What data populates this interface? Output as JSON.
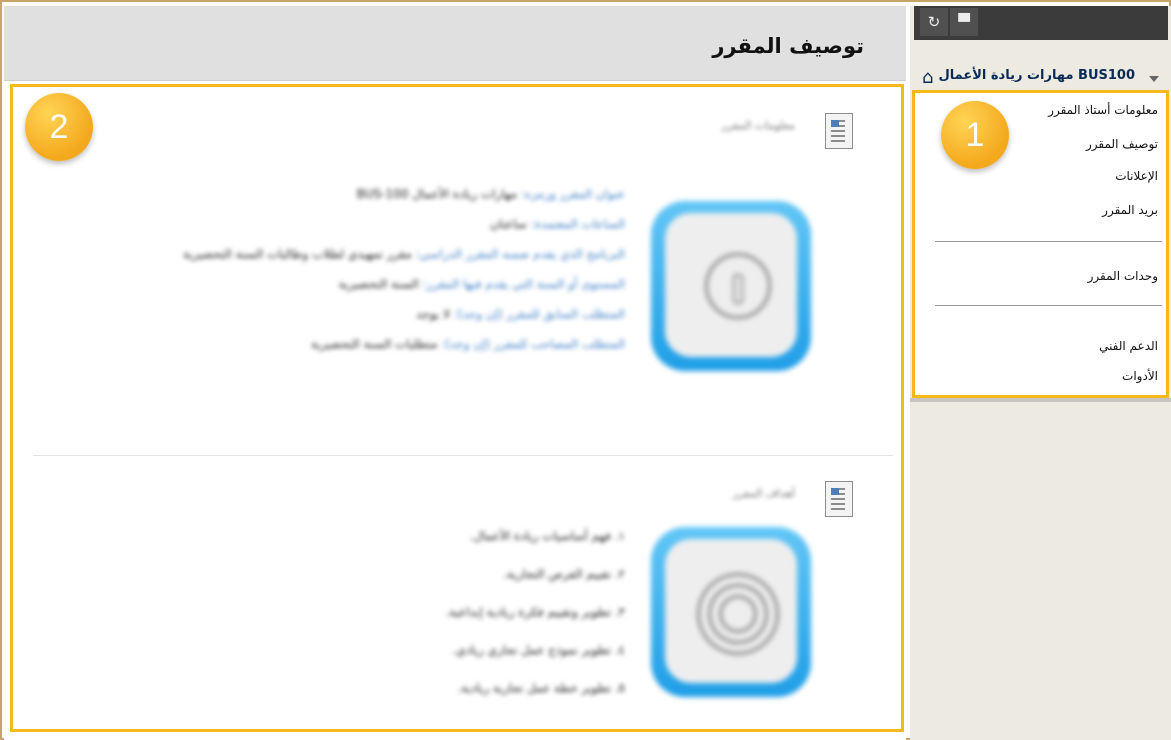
{
  "content": {
    "title": "توصيف المقرر",
    "section1": {
      "title": "معلومات المقرر",
      "lines": [
        {
          "key": "عنوان المقرر ورمزه:",
          "value": "مهارات ريادة الأعمال BUS-100"
        },
        {
          "key": "الساعات المعتمدة:",
          "value": "ساعتان"
        },
        {
          "key": "البرنامج الذي يقدم ضمنه المقرر الدراسي:",
          "value": "مقرر تمهيدي لطلاب وطالبات السنة التحضيرية"
        },
        {
          "key": "المستوى أو السنة التي يقدم فيها المقرر:",
          "value": "السنة التحضيرية"
        },
        {
          "key": "المتطلب السابق للمقرر (إن وجد):",
          "value": "لا يوجد"
        },
        {
          "key": "المتطلب المصاحب للمقرر (إن وجد):",
          "value": "متطلبات السنة التحضيرية"
        }
      ],
      "icon": "info-icon"
    },
    "section2": {
      "title": "أهداف المقرر",
      "lines": [
        "١. فهم أساسيات ريادة الأعمال.",
        "٢. تقييم الفرص التجارية.",
        "٣. تطوير وتقييم فكرة ريادية إبداعية.",
        "٤. تطوير نموذج عمل تجاري ريادي.",
        "٥. تطوير خطة عمل تجارية ريادية."
      ],
      "icon": "target-icon"
    },
    "badge": "2"
  },
  "nav": {
    "toolbar": {
      "refresh_icon": "↻",
      "folder_icon": "▀"
    },
    "course": "BUS100 مهارات ريادة الأعمال",
    "home_icon": "⌂",
    "badge": "1",
    "items": [
      "معلومات أستاذ المقرر",
      "توصيف المقرر",
      "الإعلانات",
      "بريد المقرر",
      "وحدات المقرر",
      "الدعم الفني",
      "الأدوات"
    ]
  },
  "colors": {
    "highlight": "#f5b91c",
    "nav_text": "#0a2a56",
    "link": "#3b7dc4"
  }
}
